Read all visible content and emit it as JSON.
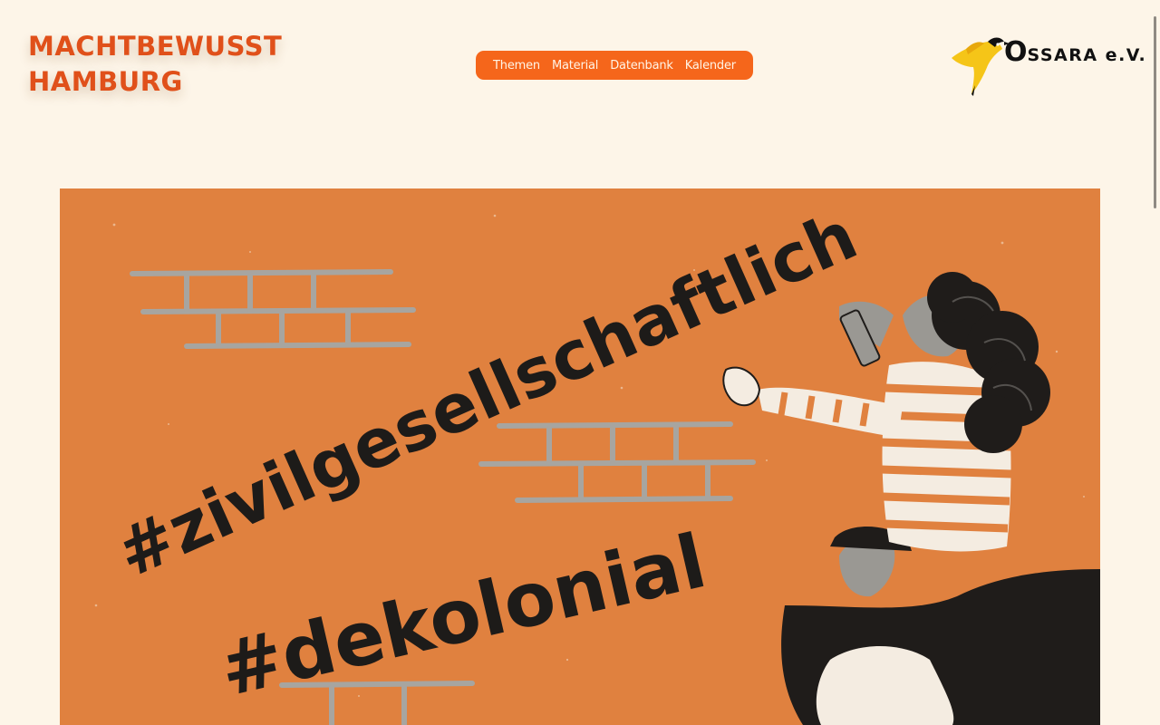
{
  "header": {
    "title_lines": [
      "MACHTBEWUSST",
      "HAMBURG"
    ]
  },
  "nav": {
    "items": [
      {
        "label": "Themen"
      },
      {
        "label": "Material"
      },
      {
        "label": "Datenbank"
      },
      {
        "label": "Kalender"
      }
    ]
  },
  "logo": {
    "first_letter": "O",
    "rest": "SSARA e.V.",
    "icon": "yellow-bird-icon"
  },
  "hero": {
    "hashtag_1": "#zivilgesellschaftlich",
    "hashtag_2": "#dekolonial",
    "colors": {
      "background": "#e0813f",
      "bricks": "#a7a5a0",
      "ink": "#1d1b19"
    }
  },
  "colors": {
    "page_background": "#fdf5e8",
    "accent": "#e0501a",
    "nav_background": "#f5661b"
  }
}
